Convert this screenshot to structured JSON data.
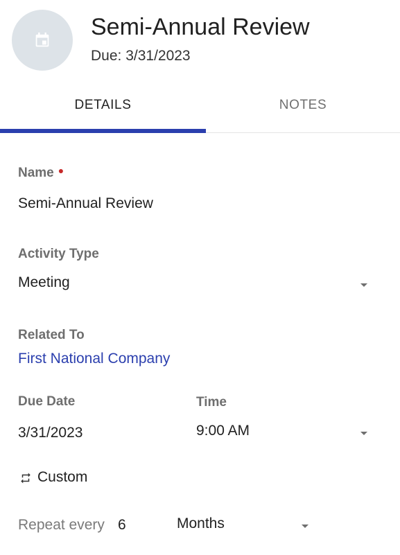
{
  "header": {
    "title": "Semi-Annual Review",
    "due_text": "Due: 3/31/2023",
    "avatar_icon": "calendar-icon",
    "avatar_bg": "#dde3e8"
  },
  "tabs": [
    {
      "label": "DETAILS",
      "active": true
    },
    {
      "label": "NOTES",
      "active": false
    }
  ],
  "accent_color": "#2b3fae",
  "form": {
    "name": {
      "label": "Name",
      "required": true,
      "value": "Semi-Annual Review"
    },
    "activity_type": {
      "label": "Activity Type",
      "value": "Meeting"
    },
    "related_to": {
      "label": "Related To",
      "value": "First National Company"
    },
    "due_date": {
      "label": "Due Date",
      "value": "3/31/2023"
    },
    "time": {
      "label": "Time",
      "value": "9:00 AM"
    },
    "recurrence": {
      "icon": "repeat-icon",
      "value": "Custom"
    },
    "repeat_every": {
      "label": "Repeat every",
      "count": "6",
      "unit": "Months"
    }
  }
}
